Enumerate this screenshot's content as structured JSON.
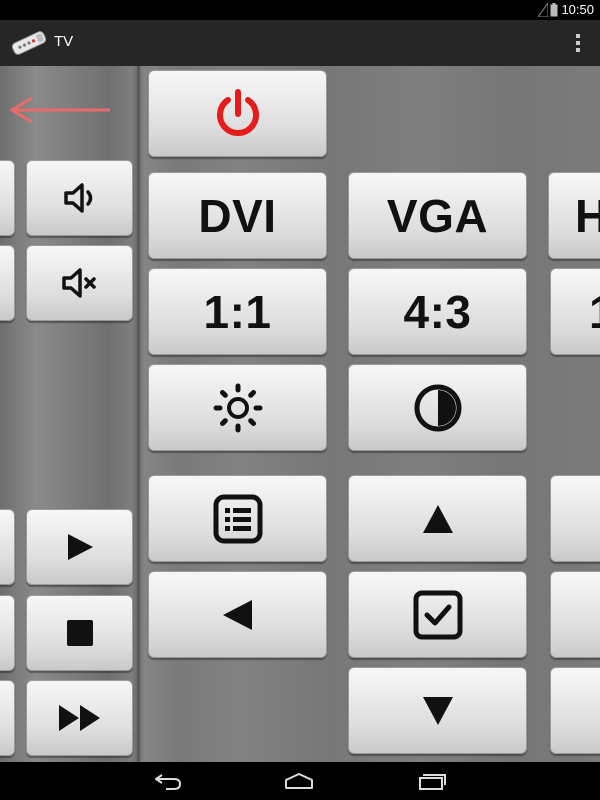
{
  "status": {
    "time": "10:50"
  },
  "actionbar": {
    "title": "TV",
    "app_icon": "remote-icon",
    "overflow_icon": "more-vert-icon"
  },
  "top_arrow_icon": "arrow-left-icon",
  "buttons": {
    "power": {
      "icon": "power-icon",
      "color": "#e61c1c"
    },
    "dvi": {
      "label": "DVI"
    },
    "vga": {
      "label": "VGA"
    },
    "hdmi_partial": {
      "label": "H"
    },
    "ratio_1_1": {
      "label": "1:1"
    },
    "ratio_4_3": {
      "label": "4:3"
    },
    "partial_right_label": {
      "label": "1"
    },
    "brightness": {
      "icon": "brightness-icon"
    },
    "contrast": {
      "icon": "contrast-icon"
    },
    "menu": {
      "icon": "list-icon"
    },
    "up": {
      "icon": "triangle-up-icon"
    },
    "left": {
      "icon": "triangle-left-icon"
    },
    "ok": {
      "icon": "checkbox-icon"
    },
    "down": {
      "icon": "triangle-down-icon"
    },
    "volume_up": {
      "icon": "volume-icon"
    },
    "mute": {
      "icon": "mute-icon"
    },
    "play": {
      "icon": "play-icon"
    },
    "stop": {
      "icon": "stop-icon"
    },
    "fast_forward": {
      "icon": "fast-forward-icon"
    }
  },
  "navbar": {
    "back_icon": "back-icon",
    "home_icon": "home-icon",
    "recents_icon": "recents-icon"
  }
}
